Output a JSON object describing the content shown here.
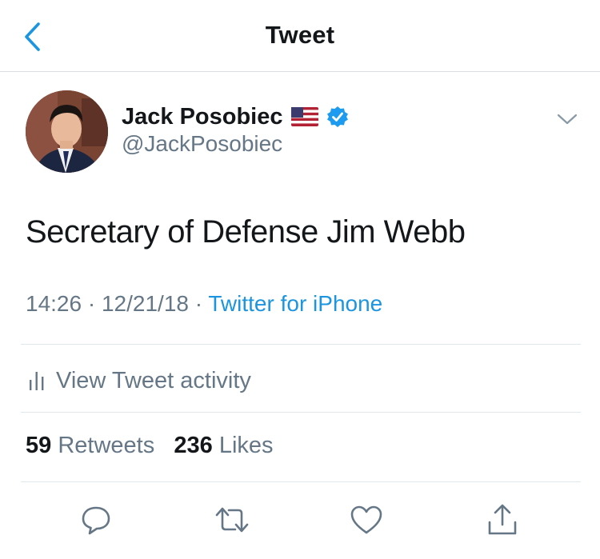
{
  "nav": {
    "title": "Tweet",
    "back_icon": "chevron-left-icon"
  },
  "tweet": {
    "author_name": "Jack Posobiec",
    "flag_emoji": "🇺🇸",
    "handle": "@JackPosobiec",
    "verified": true,
    "text": "Secretary of Defense Jim Webb",
    "time": "14:26",
    "date": "12/21/18",
    "separator": "·",
    "source": "Twitter for iPhone"
  },
  "activity": {
    "label": "View Tweet activity",
    "icon": "bar-chart-icon"
  },
  "stats": {
    "retweets_count": "59",
    "retweets_label": "Retweets",
    "likes_count": "236",
    "likes_label": "Likes"
  },
  "actions": [
    "reply-icon",
    "retweet-icon",
    "like-icon",
    "share-icon"
  ],
  "colors": {
    "accent": "#1b95e0",
    "secondary_text": "#657786",
    "primary_text": "#14171a",
    "divider": "#e1e8ed"
  }
}
